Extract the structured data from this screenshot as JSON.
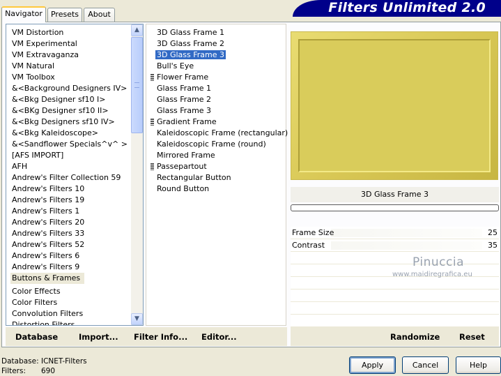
{
  "tabs": [
    {
      "label": "Navigator",
      "active": true
    },
    {
      "label": "Presets",
      "active": false
    },
    {
      "label": "About",
      "active": false
    }
  ],
  "brand": {
    "title": "Filters Unlimited 2.0",
    "color": "#00008a"
  },
  "categories": {
    "items": [
      "VM Distortion",
      "VM Experimental",
      "VM Extravaganza",
      "VM Natural",
      "VM Toolbox",
      "&<Background Designers IV>",
      "&<Bkg Designer sf10 I>",
      "&<BKg Designer sf10 II>",
      "&<Bkg Designers sf10 IV>",
      "&<Bkg Kaleidoscope>",
      "&<Sandflower Specials^v^ >",
      "[AFS IMPORT]",
      "AFH",
      "Andrew's Filter Collection 59",
      "Andrew's Filters 10",
      "Andrew's Filters 19",
      "Andrew's Filters 1",
      "Andrew's Filters 20",
      "Andrew's Filters 33",
      "Andrew's Filters 52",
      "Andrew's Filters 6",
      "Andrew's Filters 9",
      "Buttons & Frames",
      "Color Effects",
      "Color Filters",
      "Convolution Filters",
      "Distortion Filters"
    ],
    "selected": "Buttons & Frames"
  },
  "filters": {
    "items": [
      {
        "label": "3D Glass Frame 1",
        "separator": false
      },
      {
        "label": "3D Glass Frame 2",
        "separator": false
      },
      {
        "label": "3D Glass Frame 3",
        "separator": false,
        "selected": true
      },
      {
        "label": "Bull's Eye",
        "separator": false
      },
      {
        "label": "Flower Frame",
        "separator": true
      },
      {
        "label": "Glass Frame 1",
        "separator": false
      },
      {
        "label": "Glass Frame 2",
        "separator": false
      },
      {
        "label": "Glass Frame 3",
        "separator": false
      },
      {
        "label": "Gradient Frame",
        "separator": true
      },
      {
        "label": "Kaleidoscopic Frame (rectangular)",
        "separator": false
      },
      {
        "label": "Kaleidoscopic Frame (round)",
        "separator": false
      },
      {
        "label": "Mirrored Frame",
        "separator": false
      },
      {
        "label": "Passepartout",
        "separator": true
      },
      {
        "label": "Rectangular Button",
        "separator": false
      },
      {
        "label": "Round Button",
        "separator": false
      }
    ]
  },
  "preview": {
    "title": "3D Glass Frame 3",
    "frame_color": "#d9cc5b"
  },
  "params": [
    {
      "label": "Frame Size",
      "value": "25"
    },
    {
      "label": "Contrast",
      "value": "35"
    }
  ],
  "watermark": {
    "name": "Pinuccia",
    "url": "www.maidiregrafica.eu"
  },
  "left_links": {
    "database": "Database",
    "import": "Import...",
    "filter_info": "Filter Info...",
    "editor": "Editor..."
  },
  "right_links": {
    "randomize": "Randomize",
    "reset": "Reset"
  },
  "status": {
    "database_label": "Database:",
    "database_value": "ICNET-Filters",
    "filters_label": "Filters:",
    "filters_value": "690"
  },
  "buttons": {
    "apply": "Apply",
    "cancel": "Cancel",
    "help": "Help"
  }
}
